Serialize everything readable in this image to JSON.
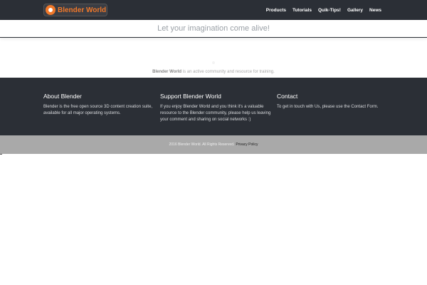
{
  "header": {
    "logo_text": "Blender World",
    "nav": [
      "Products",
      "Tutorials",
      "Quik-Tips!",
      "Gallery",
      "News"
    ]
  },
  "tagline": "Let your imagination come alive!",
  "intro": {
    "brand": "Blender World",
    "text": " is an active community and resource for training."
  },
  "footer": {
    "about": {
      "title": "About Blender",
      "body": "Blender is the free open source 3D content creation suite, available for all major operating systems."
    },
    "support": {
      "title": "Support Blender World",
      "body": "If you enjoy Blender World and you think it's a valuable resource to the Blender community, please help us leaving your comment and sharing on social networks :)"
    },
    "contact": {
      "title": "Contact",
      "body": "To get in touch with Us, please use the Contact Form."
    }
  },
  "copyright": {
    "text": "2016 Blender World. All Rights Reserved.",
    "policy": "Privacy Policy"
  },
  "colors": {
    "accent": "#f0782a",
    "dark": "#2b2f36",
    "bottombar": "#a9a9a9"
  },
  "icons": {
    "logo": "blender-logo-icon"
  }
}
